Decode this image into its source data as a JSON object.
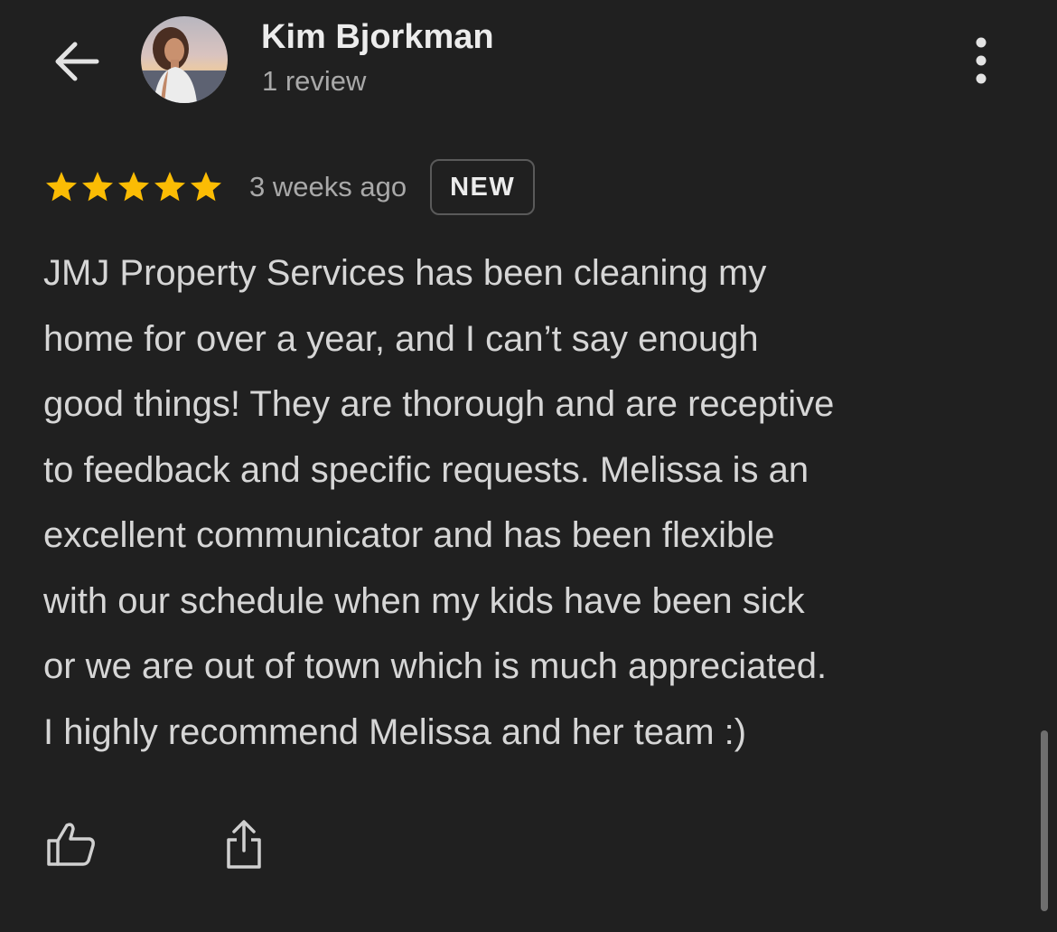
{
  "header": {
    "back_icon": "arrow-left-icon",
    "author_name": "Kim Bjorkman",
    "review_count": "1 review",
    "more_icon": "more-vertical-icon"
  },
  "review": {
    "rating": 5,
    "rating_max": 5,
    "time": "3 weeks ago",
    "badge": "NEW",
    "text_lines": [
      "JMJ Property Services has been cleaning my",
      "home for over a year, and I can’t say enough",
      "good things! They are thorough and are receptive",
      "to feedback and specific requests. Melissa is an",
      "excellent communicator and has been flexible",
      "with our schedule when my kids have been sick",
      "or we are out of town which is much appreciated.",
      "I highly recommend Melissa and her team :)"
    ]
  },
  "actions": {
    "like_icon": "thumbs-up-icon",
    "share_icon": "share-icon"
  },
  "colors": {
    "background": "#202020",
    "star": "#FBBC04",
    "text_primary": "#ececec",
    "text_body": "#d6d6d6",
    "text_secondary": "#a9a9a9",
    "badge_border": "#5a5a5a"
  }
}
